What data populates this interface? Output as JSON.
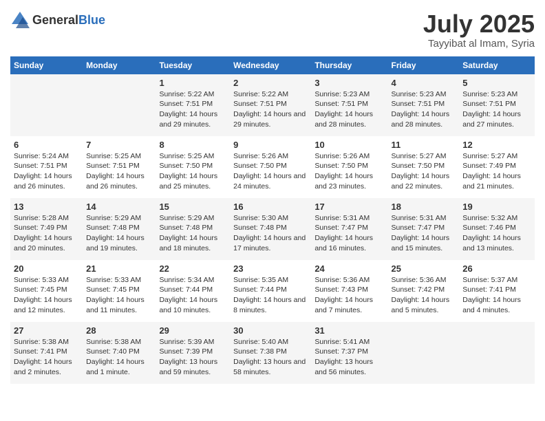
{
  "header": {
    "logo_general": "General",
    "logo_blue": "Blue",
    "month_year": "July 2025",
    "location": "Tayyibat al Imam, Syria"
  },
  "days_of_week": [
    "Sunday",
    "Monday",
    "Tuesday",
    "Wednesday",
    "Thursday",
    "Friday",
    "Saturday"
  ],
  "weeks": [
    [
      {
        "day": "",
        "sunrise": "",
        "sunset": "",
        "daylight": ""
      },
      {
        "day": "",
        "sunrise": "",
        "sunset": "",
        "daylight": ""
      },
      {
        "day": "1",
        "sunrise": "Sunrise: 5:22 AM",
        "sunset": "Sunset: 7:51 PM",
        "daylight": "Daylight: 14 hours and 29 minutes."
      },
      {
        "day": "2",
        "sunrise": "Sunrise: 5:22 AM",
        "sunset": "Sunset: 7:51 PM",
        "daylight": "Daylight: 14 hours and 29 minutes."
      },
      {
        "day": "3",
        "sunrise": "Sunrise: 5:23 AM",
        "sunset": "Sunset: 7:51 PM",
        "daylight": "Daylight: 14 hours and 28 minutes."
      },
      {
        "day": "4",
        "sunrise": "Sunrise: 5:23 AM",
        "sunset": "Sunset: 7:51 PM",
        "daylight": "Daylight: 14 hours and 28 minutes."
      },
      {
        "day": "5",
        "sunrise": "Sunrise: 5:23 AM",
        "sunset": "Sunset: 7:51 PM",
        "daylight": "Daylight: 14 hours and 27 minutes."
      }
    ],
    [
      {
        "day": "6",
        "sunrise": "Sunrise: 5:24 AM",
        "sunset": "Sunset: 7:51 PM",
        "daylight": "Daylight: 14 hours and 26 minutes."
      },
      {
        "day": "7",
        "sunrise": "Sunrise: 5:25 AM",
        "sunset": "Sunset: 7:51 PM",
        "daylight": "Daylight: 14 hours and 26 minutes."
      },
      {
        "day": "8",
        "sunrise": "Sunrise: 5:25 AM",
        "sunset": "Sunset: 7:50 PM",
        "daylight": "Daylight: 14 hours and 25 minutes."
      },
      {
        "day": "9",
        "sunrise": "Sunrise: 5:26 AM",
        "sunset": "Sunset: 7:50 PM",
        "daylight": "Daylight: 14 hours and 24 minutes."
      },
      {
        "day": "10",
        "sunrise": "Sunrise: 5:26 AM",
        "sunset": "Sunset: 7:50 PM",
        "daylight": "Daylight: 14 hours and 23 minutes."
      },
      {
        "day": "11",
        "sunrise": "Sunrise: 5:27 AM",
        "sunset": "Sunset: 7:50 PM",
        "daylight": "Daylight: 14 hours and 22 minutes."
      },
      {
        "day": "12",
        "sunrise": "Sunrise: 5:27 AM",
        "sunset": "Sunset: 7:49 PM",
        "daylight": "Daylight: 14 hours and 21 minutes."
      }
    ],
    [
      {
        "day": "13",
        "sunrise": "Sunrise: 5:28 AM",
        "sunset": "Sunset: 7:49 PM",
        "daylight": "Daylight: 14 hours and 20 minutes."
      },
      {
        "day": "14",
        "sunrise": "Sunrise: 5:29 AM",
        "sunset": "Sunset: 7:48 PM",
        "daylight": "Daylight: 14 hours and 19 minutes."
      },
      {
        "day": "15",
        "sunrise": "Sunrise: 5:29 AM",
        "sunset": "Sunset: 7:48 PM",
        "daylight": "Daylight: 14 hours and 18 minutes."
      },
      {
        "day": "16",
        "sunrise": "Sunrise: 5:30 AM",
        "sunset": "Sunset: 7:48 PM",
        "daylight": "Daylight: 14 hours and 17 minutes."
      },
      {
        "day": "17",
        "sunrise": "Sunrise: 5:31 AM",
        "sunset": "Sunset: 7:47 PM",
        "daylight": "Daylight: 14 hours and 16 minutes."
      },
      {
        "day": "18",
        "sunrise": "Sunrise: 5:31 AM",
        "sunset": "Sunset: 7:47 PM",
        "daylight": "Daylight: 14 hours and 15 minutes."
      },
      {
        "day": "19",
        "sunrise": "Sunrise: 5:32 AM",
        "sunset": "Sunset: 7:46 PM",
        "daylight": "Daylight: 14 hours and 13 minutes."
      }
    ],
    [
      {
        "day": "20",
        "sunrise": "Sunrise: 5:33 AM",
        "sunset": "Sunset: 7:45 PM",
        "daylight": "Daylight: 14 hours and 12 minutes."
      },
      {
        "day": "21",
        "sunrise": "Sunrise: 5:33 AM",
        "sunset": "Sunset: 7:45 PM",
        "daylight": "Daylight: 14 hours and 11 minutes."
      },
      {
        "day": "22",
        "sunrise": "Sunrise: 5:34 AM",
        "sunset": "Sunset: 7:44 PM",
        "daylight": "Daylight: 14 hours and 10 minutes."
      },
      {
        "day": "23",
        "sunrise": "Sunrise: 5:35 AM",
        "sunset": "Sunset: 7:44 PM",
        "daylight": "Daylight: 14 hours and 8 minutes."
      },
      {
        "day": "24",
        "sunrise": "Sunrise: 5:36 AM",
        "sunset": "Sunset: 7:43 PM",
        "daylight": "Daylight: 14 hours and 7 minutes."
      },
      {
        "day": "25",
        "sunrise": "Sunrise: 5:36 AM",
        "sunset": "Sunset: 7:42 PM",
        "daylight": "Daylight: 14 hours and 5 minutes."
      },
      {
        "day": "26",
        "sunrise": "Sunrise: 5:37 AM",
        "sunset": "Sunset: 7:41 PM",
        "daylight": "Daylight: 14 hours and 4 minutes."
      }
    ],
    [
      {
        "day": "27",
        "sunrise": "Sunrise: 5:38 AM",
        "sunset": "Sunset: 7:41 PM",
        "daylight": "Daylight: 14 hours and 2 minutes."
      },
      {
        "day": "28",
        "sunrise": "Sunrise: 5:38 AM",
        "sunset": "Sunset: 7:40 PM",
        "daylight": "Daylight: 14 hours and 1 minute."
      },
      {
        "day": "29",
        "sunrise": "Sunrise: 5:39 AM",
        "sunset": "Sunset: 7:39 PM",
        "daylight": "Daylight: 13 hours and 59 minutes."
      },
      {
        "day": "30",
        "sunrise": "Sunrise: 5:40 AM",
        "sunset": "Sunset: 7:38 PM",
        "daylight": "Daylight: 13 hours and 58 minutes."
      },
      {
        "day": "31",
        "sunrise": "Sunrise: 5:41 AM",
        "sunset": "Sunset: 7:37 PM",
        "daylight": "Daylight: 13 hours and 56 minutes."
      },
      {
        "day": "",
        "sunrise": "",
        "sunset": "",
        "daylight": ""
      },
      {
        "day": "",
        "sunrise": "",
        "sunset": "",
        "daylight": ""
      }
    ]
  ]
}
